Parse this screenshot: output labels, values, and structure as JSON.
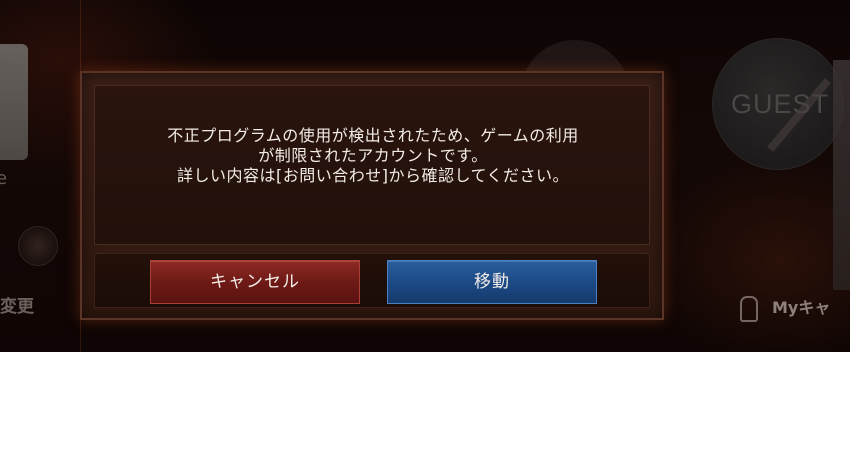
{
  "dialog": {
    "message_lines": [
      "不正プログラムの使用が検出されたため、ゲームの利用",
      "が制限されたアカウントです。",
      "詳しい内容は[お問い合わせ]から確認してください。"
    ],
    "cancel_label": "キャンセル",
    "move_label": "移動"
  },
  "background": {
    "guest_label": "GUEST",
    "left_label": "変更",
    "left_glyph": "e",
    "right_label": "Myキャ"
  },
  "colors": {
    "cancel_button": "#7a1f1a",
    "move_button": "#1f4e8a",
    "dialog_bg": "#33190f"
  }
}
